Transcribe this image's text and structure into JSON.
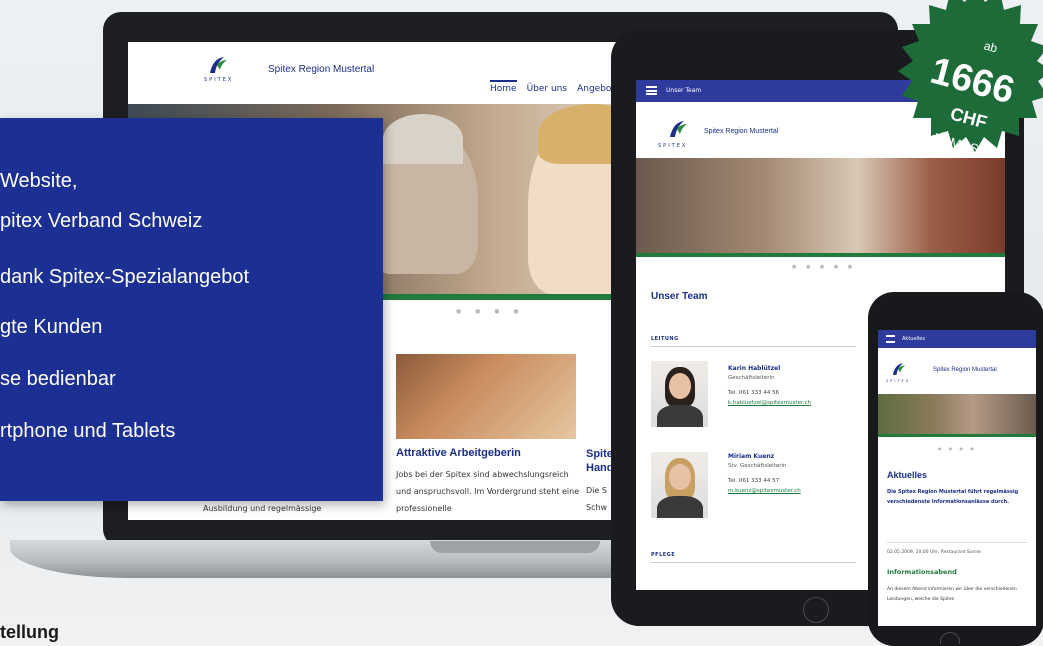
{
  "panel": {
    "lines": [
      "Website,",
      "pitex Verband Schweiz",
      "dank Spitex-Spezialangebot",
      "gte Kunden",
      "se bedienbar",
      "rtphone und Tablets"
    ]
  },
  "laptop": {
    "site_name": "Spitex Region Mustertal",
    "logo_sub": "SPITEX",
    "nav": [
      "Home",
      "Über uns",
      "Angebot"
    ],
    "card1_title": "Attraktive Arbeitgeberin",
    "card1_text": "Jobs bei der Spitex sind abwechslungsreich und anspruchsvoll. Im Vordergrund steht eine professionelle",
    "card2_title_line1": "Spite",
    "card2_title_line2": "Hand",
    "card2_text_line1": "Die S",
    "card2_text_line2": "Schw",
    "left_snippet": "Ausbildung und regelmässige"
  },
  "tablet": {
    "topbar_label": "Unser Team",
    "site_name": "Spitex Region Mustertal",
    "logo_sub": "SPITEX",
    "heading": "Unser Team",
    "section_leitung": "LEITUNG",
    "section_pflege": "PFLEGE",
    "people": [
      {
        "name": "Karin Hablützel",
        "role": "Geschäftsleiterin",
        "tel": "Tel. 061 333 44 56",
        "mail": "k.habluetzel@spitexmuster.ch"
      },
      {
        "name": "Miriam Kuenz",
        "role": "Stv. Geschäftsleiterin",
        "tel": "Tel. 061 333 44 57",
        "mail": "m.kuenz@spitexmuster.ch"
      }
    ]
  },
  "phone": {
    "topbar_label": "Aktuelles",
    "site_name": "Spitex Region Mustertal",
    "logo_sub": "SPITEX",
    "heading": "Aktuelles",
    "intro": "Die Spitex Region Mustertal führt regelmässig verschiedenste Informationsanlässe durch.",
    "date": "02.05.2009, 20.00 Uhr, Restaurant Sonne",
    "subheading": "Informationsabend",
    "body": "An diesem Abend informieren wir über die verschiedenen Leistungen, welche die Spitex"
  },
  "price": {
    "prefix": "ab",
    "amount": "1666",
    "currency": "CHF",
    "note": "exkl. MwSt."
  },
  "bottom_left_text": "tellung",
  "colors": {
    "brand_blue": "#1c2f92",
    "green": "#1f7a3c",
    "starburst": "#1e6b3a"
  }
}
